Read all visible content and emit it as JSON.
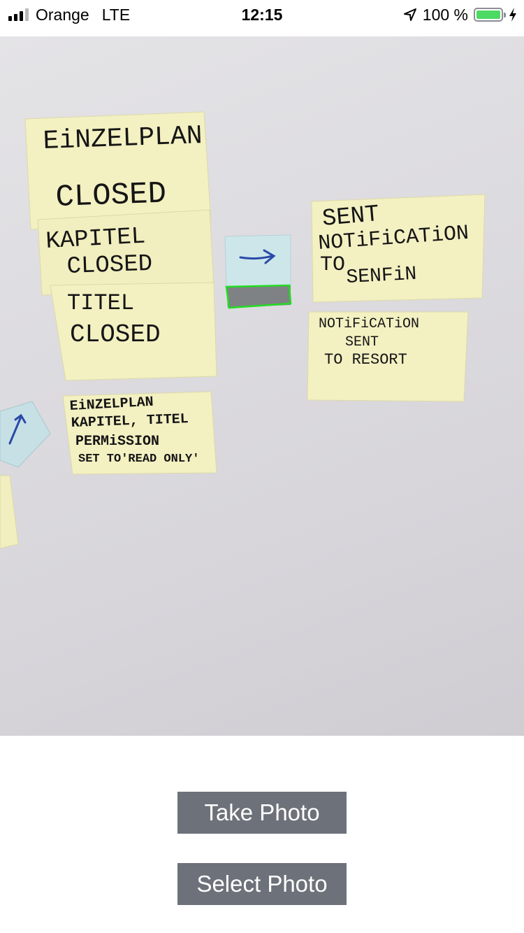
{
  "status_bar": {
    "carrier": "Orange",
    "network": "LTE",
    "time": "12:15",
    "battery": "100 %",
    "battery_level": 1.0,
    "icons": [
      "signal-icon",
      "location-arrow-icon",
      "battery-icon",
      "charging-bolt-icon"
    ]
  },
  "photo": {
    "description_icon": "camera-preview",
    "detection_box_color": "#22dd22",
    "notes": {
      "einzelplan": [
        "EiNZELPLAN",
        "CLOSED"
      ],
      "kapitel": [
        "KAPITEL",
        "CLOSED"
      ],
      "titel": [
        "TITEL",
        "CLOSED"
      ],
      "permission": [
        "EiNZELPLAN",
        "KAPITEL, TITEL",
        "PERMiSSION",
        "SET TO'READ ONLY'"
      ],
      "sent_notification": [
        "SENT",
        "NOTiFiCATiON",
        "TO",
        "SENFiN"
      ],
      "notification_resort": [
        "NOTiFiCATiON",
        "SENT",
        "TO RESORT"
      ]
    }
  },
  "buttons": {
    "take_photo": "Take Photo",
    "select_photo": "Select Photo"
  },
  "colors": {
    "button_bg": "#6d7179",
    "note_yellow": "#f3f0c2",
    "note_blue": "#cde6ea",
    "battery_green": "#4cd964"
  }
}
